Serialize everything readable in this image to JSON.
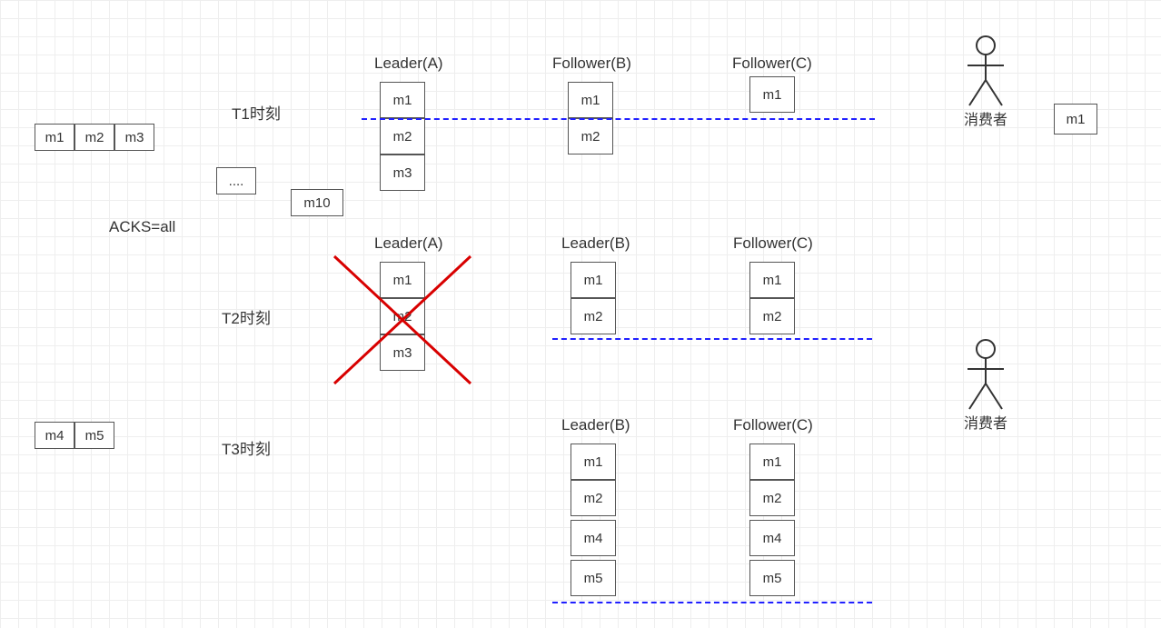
{
  "producer_t1": {
    "cells": [
      "m1",
      "m2",
      "m3"
    ]
  },
  "buffer_dots": "....",
  "buffer_m10": "m10",
  "acks_label": "ACKS=all",
  "t1_label": "T1时刻",
  "t2_label": "T2时刻",
  "t3_label": "T3时刻",
  "t1": {
    "leader_a": {
      "title": "Leader(A)",
      "cells": [
        "m1",
        "m2",
        "m3"
      ]
    },
    "follower_b": {
      "title": "Follower(B)",
      "cells": [
        "m1",
        "m2"
      ]
    },
    "follower_c": {
      "title": "Follower(C)",
      "cells": [
        "m1"
      ]
    }
  },
  "t2": {
    "leader_a": {
      "title": "Leader(A)",
      "cells": [
        "m1",
        "m2",
        "m3"
      ]
    },
    "leader_b": {
      "title": "Leader(B)",
      "cells": [
        "m1",
        "m2"
      ]
    },
    "follower_c": {
      "title": "Follower(C)",
      "cells": [
        "m1",
        "m2"
      ]
    }
  },
  "t3": {
    "leader_b": {
      "title": "Leader(B)",
      "cells": [
        "m1",
        "m2",
        "m4",
        "m5"
      ]
    },
    "follower_c": {
      "title": "Follower(C)",
      "cells": [
        "m1",
        "m2",
        "m4",
        "m5"
      ]
    }
  },
  "producer_t3": {
    "cells": [
      "m4",
      "m5"
    ]
  },
  "consumer_label": "消费者",
  "consumer_recv_m1": "m1"
}
